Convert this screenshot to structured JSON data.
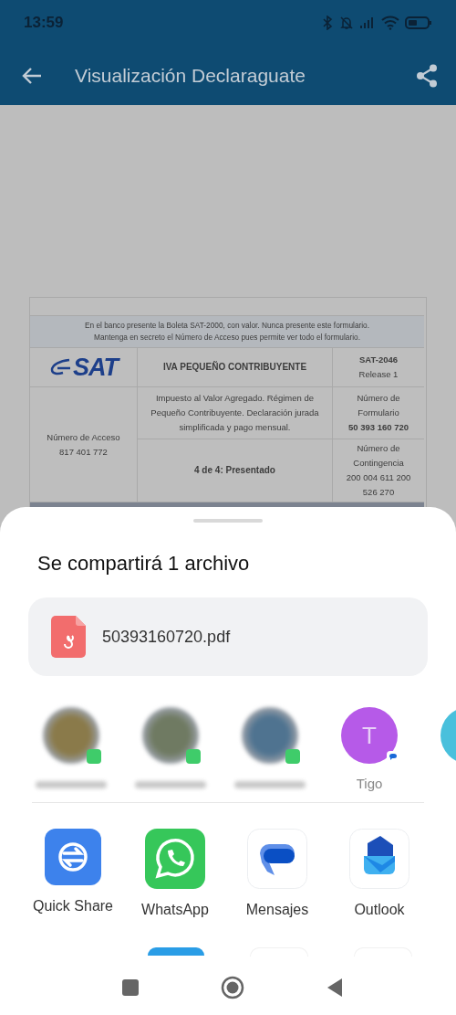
{
  "status_bar": {
    "time": "13:59"
  },
  "app_bar": {
    "title": "Visualización Declaraguate"
  },
  "document": {
    "notice_lines": [
      "En el banco presente la Boleta SAT-2000, con valor. Nunca presente este formulario.",
      "Mantenga en secreto el Número de Acceso pues permite ver todo el formulario."
    ],
    "logo_text": "SAT",
    "form_title": "IVA PEQUEÑO CONTRIBUYENTE",
    "form_code": "SAT-2046",
    "release": "Release 1",
    "description": "Impuesto al Valor Agregado. Régimen de Pequeño Contribuyente. Declaración jurada simplificada y pago mensual.",
    "access_label": "Número de Acceso",
    "access_number": "817 401 772",
    "form_number_label": "Número de Formulario",
    "form_number": "50 393 160 720",
    "status": "4 de 4: Presentado",
    "contingency_label": "Número de Contingencia",
    "contingency_number": "200 004 611 200 526 270"
  },
  "share_sheet": {
    "title": "Se compartirá 1 archivo",
    "file": {
      "name": "50393160720.pdf"
    },
    "contacts": [
      {
        "kind": "whatsapp"
      },
      {
        "kind": "whatsapp"
      },
      {
        "kind": "whatsapp"
      },
      {
        "kind": "messages",
        "letter": "T",
        "label": "Tigo",
        "color": "#b65ae8"
      },
      {
        "kind": "plain",
        "color": "#49c0dc"
      }
    ],
    "apps": [
      {
        "label": "Quick Share",
        "kind": "quickshare"
      },
      {
        "label": "WhatsApp",
        "kind": "whatsapp"
      },
      {
        "label": "Mensajes",
        "kind": "messages"
      },
      {
        "label": "Outlook",
        "kind": "outlook"
      }
    ]
  }
}
